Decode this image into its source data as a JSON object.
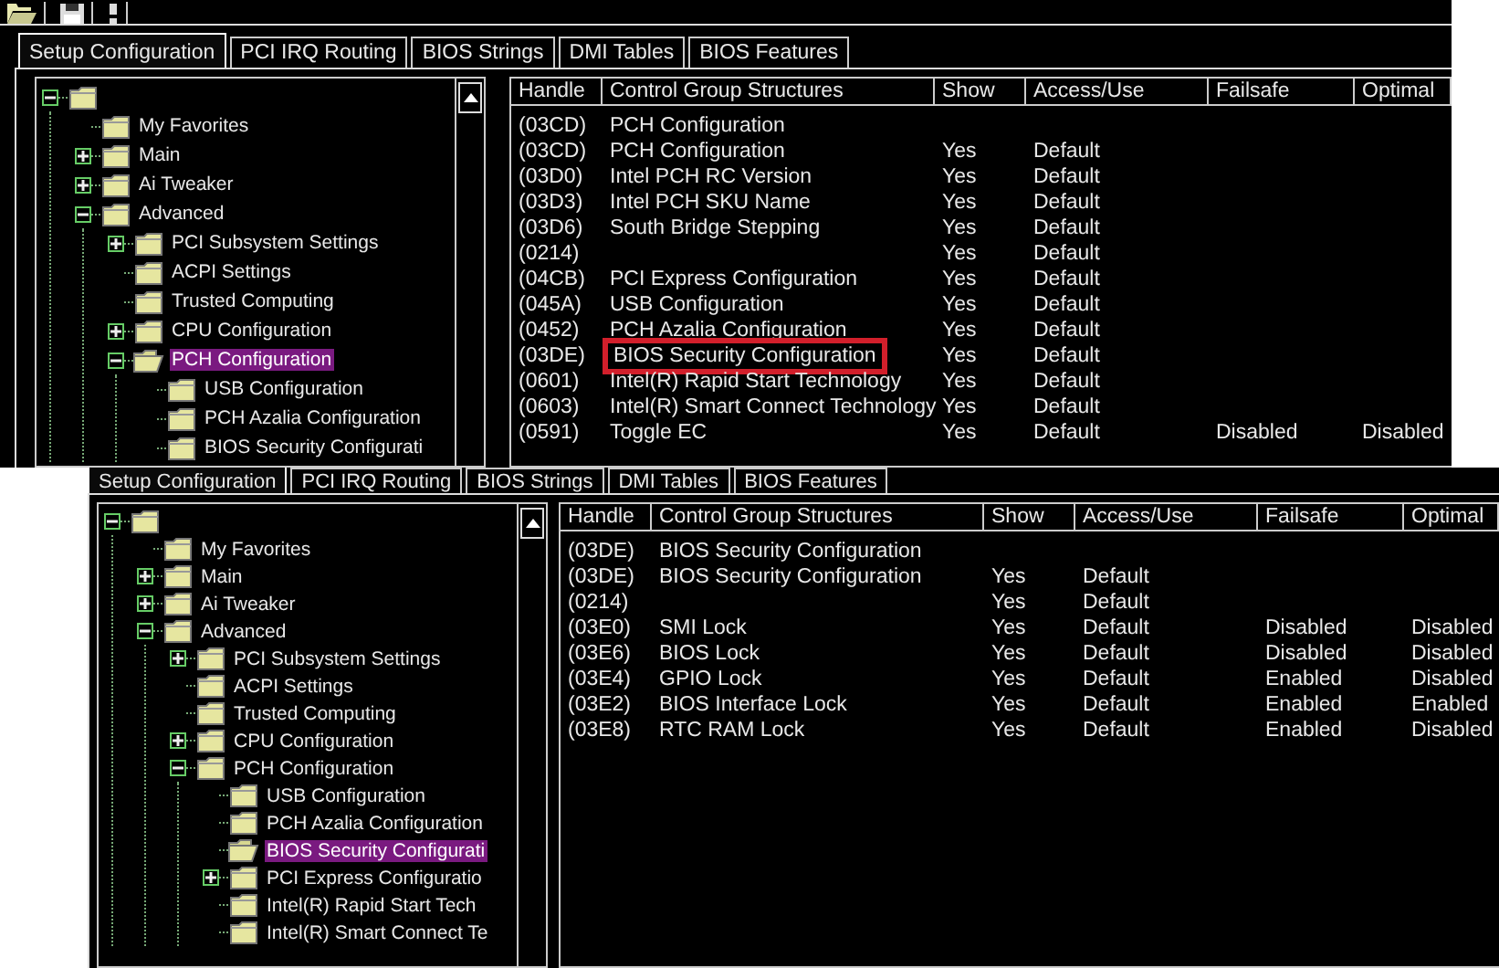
{
  "screens": [
    {
      "toolbar": true,
      "tabs": [
        {
          "label": "Setup Configuration",
          "selected": true
        },
        {
          "label": "PCI IRQ Routing",
          "selected": false
        },
        {
          "label": "BIOS Strings",
          "selected": false
        },
        {
          "label": "DMI Tables",
          "selected": false
        },
        {
          "label": "BIOS Features",
          "selected": false
        }
      ],
      "tree": {
        "has_expander": true,
        "expanded": true,
        "selected": false,
        "children": [
          {
            "label": "My Favorites",
            "has_expander": false,
            "selected": false
          },
          {
            "label": "Main",
            "has_expander": true,
            "expanded": false,
            "selected": false
          },
          {
            "label": "Ai Tweaker",
            "has_expander": true,
            "expanded": false,
            "selected": false
          },
          {
            "label": "Advanced",
            "has_expander": true,
            "expanded": true,
            "selected": false,
            "children": [
              {
                "label": "PCI Subsystem Settings",
                "has_expander": true,
                "expanded": false,
                "selected": false
              },
              {
                "label": "ACPI Settings",
                "has_expander": false,
                "selected": false
              },
              {
                "label": "Trusted Computing",
                "has_expander": false,
                "selected": false
              },
              {
                "label": "CPU Configuration",
                "has_expander": true,
                "expanded": false,
                "selected": false
              },
              {
                "label": "PCH Configuration",
                "has_expander": true,
                "expanded": true,
                "selected": true,
                "children": [
                  {
                    "label": "USB Configuration",
                    "has_expander": false,
                    "selected": false
                  },
                  {
                    "label": "PCH Azalia Configuration",
                    "has_expander": false,
                    "selected": false
                  },
                  {
                    "label": "BIOS Security Configurati",
                    "has_expander": false,
                    "selected": false
                  }
                ]
              }
            ]
          }
        ]
      },
      "table": {
        "columns": [
          "Handle",
          "Control Group Structures",
          "Show",
          "Access/Use",
          "Failsafe",
          "Optimal"
        ],
        "rows": [
          {
            "handle": "(03CD)",
            "name": "PCH Configuration",
            "highlighted": false
          },
          {
            "handle": "(03CD)",
            "name": "PCH Configuration",
            "show": "Yes",
            "access": "Default",
            "highlighted": false
          },
          {
            "handle": "(03D0)",
            "name": "Intel PCH RC Version",
            "show": "Yes",
            "access": "Default",
            "highlighted": false
          },
          {
            "handle": "(03D3)",
            "name": "Intel PCH SKU Name",
            "show": "Yes",
            "access": "Default",
            "highlighted": false
          },
          {
            "handle": "(03D6)",
            "name": "South Bridge Stepping",
            "show": "Yes",
            "access": "Default",
            "highlighted": false
          },
          {
            "handle": "(0214)",
            "show": "Yes",
            "access": "Default",
            "highlighted": false
          },
          {
            "handle": "(04CB)",
            "name": "PCI Express Configuration",
            "show": "Yes",
            "access": "Default",
            "highlighted": false
          },
          {
            "handle": "(045A)",
            "name": "USB Configuration",
            "show": "Yes",
            "access": "Default",
            "highlighted": false
          },
          {
            "handle": "(0452)",
            "name": "PCH Azalia Configuration",
            "show": "Yes",
            "access": "Default",
            "highlighted": false
          },
          {
            "handle": "(03DE)",
            "name": "BIOS Security Configuration",
            "show": "Yes",
            "access": "Default",
            "highlighted": true
          },
          {
            "handle": "(0601)",
            "name": "Intel(R) Rapid Start Technology",
            "show": "Yes",
            "access": "Default",
            "highlighted": false
          },
          {
            "handle": "(0603)",
            "name": "Intel(R) Smart Connect Technology",
            "show": "Yes",
            "access": "Default",
            "highlighted": false
          },
          {
            "handle": "(0591)",
            "name": "Toggle EC",
            "show": "Yes",
            "access": "Default",
            "failsafe": "Disabled",
            "optimal": "Disabled",
            "highlighted": false
          }
        ]
      }
    },
    {
      "toolbar": false,
      "tabs": [
        {
          "label": "Setup Configuration",
          "selected": true
        },
        {
          "label": "PCI IRQ Routing",
          "selected": false
        },
        {
          "label": "BIOS Strings",
          "selected": false
        },
        {
          "label": "DMI Tables",
          "selected": false
        },
        {
          "label": "BIOS Features",
          "selected": false
        }
      ],
      "tree": {
        "has_expander": true,
        "expanded": true,
        "selected": false,
        "children": [
          {
            "label": "My Favorites",
            "has_expander": false,
            "selected": false
          },
          {
            "label": "Main",
            "has_expander": true,
            "expanded": false,
            "selected": false
          },
          {
            "label": "Ai Tweaker",
            "has_expander": true,
            "expanded": false,
            "selected": false
          },
          {
            "label": "Advanced",
            "has_expander": true,
            "expanded": true,
            "selected": false,
            "children": [
              {
                "label": "PCI Subsystem Settings",
                "has_expander": true,
                "expanded": false,
                "selected": false
              },
              {
                "label": "ACPI Settings",
                "has_expander": false,
                "selected": false
              },
              {
                "label": "Trusted Computing",
                "has_expander": false,
                "selected": false
              },
              {
                "label": "CPU Configuration",
                "has_expander": true,
                "expanded": false,
                "selected": false
              },
              {
                "label": "PCH Configuration",
                "has_expander": true,
                "expanded": true,
                "selected": false,
                "children": [
                  {
                    "label": "USB Configuration",
                    "has_expander": false,
                    "selected": false
                  },
                  {
                    "label": "PCH Azalia Configuration",
                    "has_expander": false,
                    "selected": false
                  },
                  {
                    "label": "BIOS Security Configurati",
                    "has_expander": false,
                    "selected": true
                  },
                  {
                    "label": "PCI Express Configuratio",
                    "has_expander": true,
                    "expanded": false,
                    "selected": false
                  },
                  {
                    "label": "Intel(R) Rapid Start Tech",
                    "has_expander": false,
                    "selected": false
                  },
                  {
                    "label": "Intel(R) Smart Connect Te",
                    "has_expander": false,
                    "selected": false
                  }
                ]
              }
            ]
          }
        ]
      },
      "table": {
        "columns": [
          "Handle",
          "Control Group Structures",
          "Show",
          "Access/Use",
          "Failsafe",
          "Optimal"
        ],
        "rows": [
          {
            "handle": "(03DE)",
            "name": "BIOS Security Configuration",
            "highlighted": false
          },
          {
            "handle": "(03DE)",
            "name": "BIOS Security Configuration",
            "show": "Yes",
            "access": "Default",
            "highlighted": false
          },
          {
            "handle": "(0214)",
            "show": "Yes",
            "access": "Default",
            "highlighted": false
          },
          {
            "handle": "(03E0)",
            "name": "SMI Lock",
            "show": "Yes",
            "access": "Default",
            "failsafe": "Disabled",
            "optimal": "Disabled",
            "highlighted": false
          },
          {
            "handle": "(03E6)",
            "name": "BIOS Lock",
            "show": "Yes",
            "access": "Default",
            "failsafe": "Disabled",
            "optimal": "Disabled",
            "highlighted": false
          },
          {
            "handle": "(03E4)",
            "name": "GPIO Lock",
            "show": "Yes",
            "access": "Default",
            "failsafe": "Enabled",
            "optimal": "Disabled",
            "highlighted": false
          },
          {
            "handle": "(03E2)",
            "name": "BIOS Interface Lock",
            "show": "Yes",
            "access": "Default",
            "failsafe": "Enabled",
            "optimal": "Enabled",
            "highlighted": false
          },
          {
            "handle": "(03E8)",
            "name": "RTC RAM Lock",
            "show": "Yes",
            "access": "Default",
            "failsafe": "Enabled",
            "optimal": "Disabled",
            "highlighted": false
          }
        ]
      }
    }
  ]
}
